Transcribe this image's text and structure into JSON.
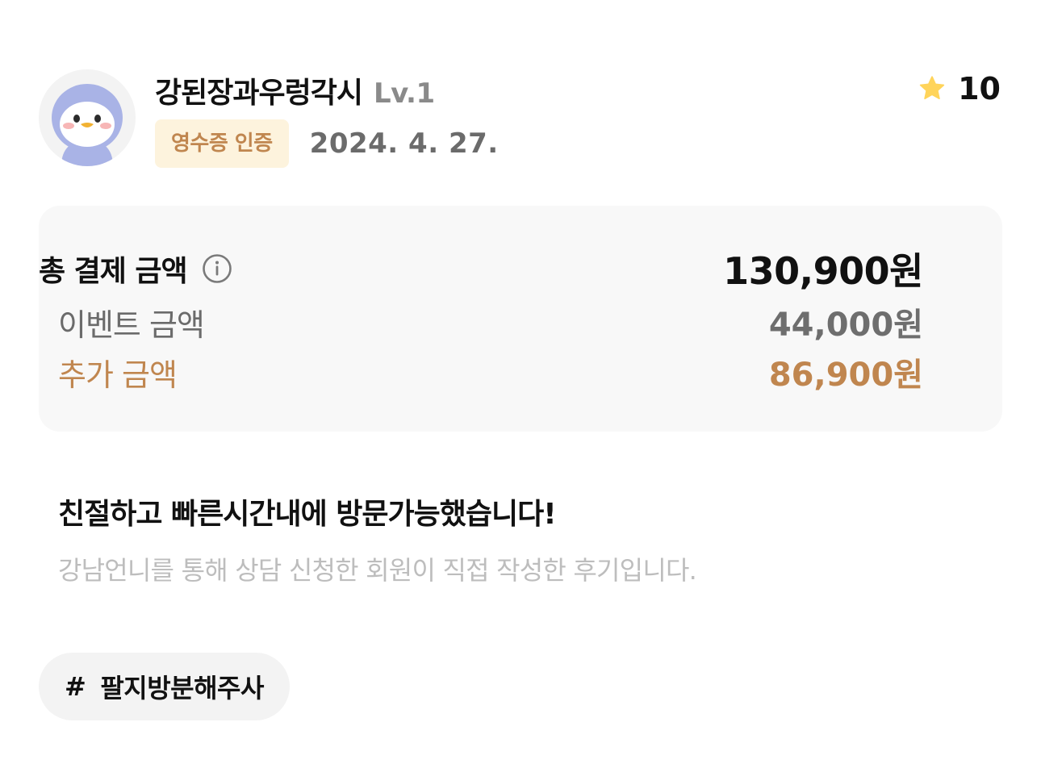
{
  "review": {
    "user": {
      "nickname": "강된장과우렁각시",
      "level": "Lv.1",
      "avatar_icon": "penguin-avatar"
    },
    "badge": "영수증 인증",
    "date": "2024. 4. 27.",
    "rating": {
      "icon": "star-icon",
      "value": "10",
      "star_color": "#FFD45A"
    },
    "price": {
      "total_label": "총 결제 금액",
      "total_value": "130,900원",
      "info_icon": "info-icon",
      "event_label": "이벤트 금액",
      "event_value": "44,000원",
      "extra_label": "추가 금액",
      "extra_value": "86,900원",
      "accent_color": "#C0864F"
    },
    "title": "친절하고 빠른시간내에 방문가능했습니다!",
    "note": "강남언니를 통해 상담 신청한 회원이 직접 작성한 후기입니다.",
    "hashtag": {
      "symbol": "#",
      "text": "팔지방분해주사"
    }
  }
}
